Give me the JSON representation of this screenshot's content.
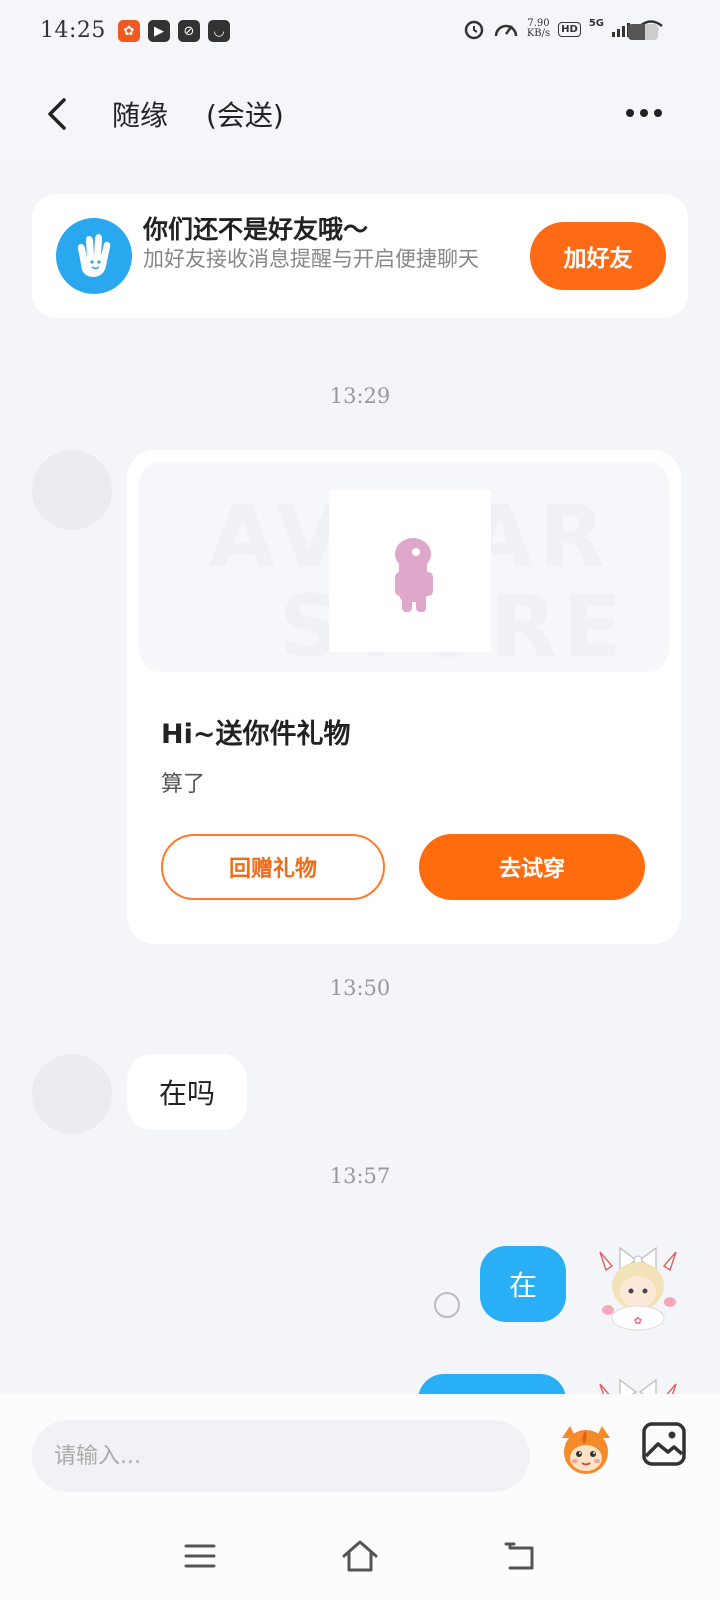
{
  "status_bar": {
    "time": "14:25",
    "net_speed_value": "7.90",
    "net_speed_unit": "KB/s",
    "hd_label": "HD",
    "network_label": "5G",
    "battery_level": 0.55
  },
  "header": {
    "name": "随缘",
    "subtitle": "(会送)"
  },
  "friend_banner": {
    "title": "你们还不是好友哦～",
    "description": "加好友接收消息提醒与开启便捷聊天",
    "button_label": "加好友"
  },
  "messages": [
    {
      "timestamp": "13:29",
      "type": "gift-card",
      "banner_text_1": "AVATAR",
      "banner_text_2": "STORE",
      "title": "Hi~送你件礼物",
      "subtitle": "算了",
      "secondary_button": "回赠礼物",
      "primary_button": "去试穿"
    },
    {
      "timestamp": "13:50",
      "type": "text-incoming",
      "text": "在吗"
    },
    {
      "timestamp": "13:57",
      "type": "text-outgoing",
      "text": "在"
    }
  ],
  "input": {
    "placeholder": "请输入..."
  },
  "colors": {
    "accent_orange": "#ff6c0e",
    "bubble_blue": "#29aff5",
    "background": "#f3f5f9"
  },
  "icons": {
    "back": "chevron-left-icon",
    "more": "more-dots-icon",
    "wave": "waving-hand-icon",
    "emoji": "emoji-mascot-icon",
    "image": "image-icon",
    "nav_menu": "menu-icon",
    "nav_home": "home-icon",
    "nav_back": "back-icon"
  }
}
